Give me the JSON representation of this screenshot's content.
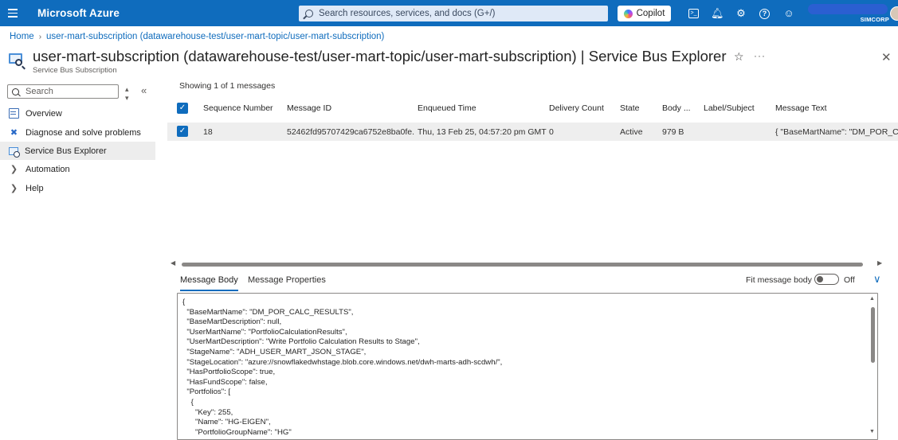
{
  "topbar": {
    "brand": "Microsoft Azure",
    "search_placeholder": "Search resources, services, and docs (G+/)",
    "copilot_label": "Copilot",
    "tenant": "SIMCORP",
    "icons": [
      "cloud-shell-icon",
      "bell-icon",
      "gear-icon",
      "help-icon",
      "feedback-icon"
    ]
  },
  "breadcrumb": {
    "home": "Home",
    "current": "user-mart-subscription (datawarehouse-test/user-mart-topic/user-mart-subscription)"
  },
  "page": {
    "title": "user-mart-subscription (datawarehouse-test/user-mart-topic/user-mart-subscription)",
    "title_suffix": " | Service Bus Explorer",
    "subtitle": "Service Bus Subscription"
  },
  "sidebar": {
    "search_placeholder": "Search",
    "items": [
      {
        "label": "Overview"
      },
      {
        "label": "Diagnose and solve problems"
      },
      {
        "label": "Service Bus Explorer"
      },
      {
        "label": "Automation"
      },
      {
        "label": "Help"
      }
    ]
  },
  "messages": {
    "showing": "Showing 1 of 1 messages",
    "columns": [
      "Sequence Number",
      "Message ID",
      "Enqueued Time",
      "Delivery Count",
      "State",
      "Body ...",
      "Label/Subject",
      "Message Text"
    ],
    "rows": [
      {
        "sequence": "18",
        "message_id": "52462fd95707429ca6752e8ba0fe...",
        "enqueued": "Thu, 13 Feb 25, 04:57:20 pm GMT",
        "delivery_count": "0",
        "state": "Active",
        "body_size": "979 B",
        "label": "",
        "text": "{ \"BaseMartName\": \"DM_POR_CA"
      }
    ]
  },
  "detail": {
    "tabs": [
      "Message Body",
      "Message Properties"
    ],
    "fit_label": "Fit message body",
    "toggle_text": "Off",
    "body_lines": [
      "{",
      "  \"BaseMartName\": \"DM_POR_CALC_RESULTS\",",
      "  \"BaseMartDescription\": null,",
      "  \"UserMartName\": \"PortfolioCalculationResults\",",
      "  \"UserMartDescription\": \"Write Portfolio Calculation Results to Stage\",",
      "  \"StageName\": \"ADH_USER_MART_JSON_STAGE\",",
      "  \"StageLocation\": \"azure://snowflakedwhstage.blob.core.windows.net/dwh-marts-adh-scdwh/\",",
      "  \"HasPortfolioScope\": true,",
      "  \"HasFundScope\": false,",
      "  \"Portfolios\": [",
      "    {",
      "      \"Key\": 255,",
      "      \"Name\": \"HG-EIGEN\",",
      "      \"PortfolioGroupName\": \"HG\""
    ]
  }
}
